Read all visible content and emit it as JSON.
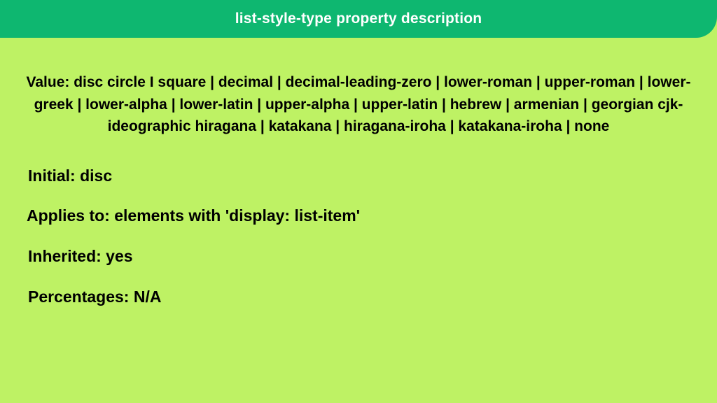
{
  "header": {
    "title": "list-style-type property description"
  },
  "content": {
    "value_line": "Value:  disc circle I square | decimal | decimal-leading-zero | lower-roman | upper-roman | lower- greek | lower-alpha | lower-latin | upper-alpha | upper-latin | hebrew | armenian | georgian cjk-ideographic hiragana | katakana | hiragana-iroha | katakana-iroha | none",
    "initial": "Initial: disc",
    "applies_to": "Applies to: elements with 'display: list-item'",
    "inherited": "Inherited: yes",
    "percentages": "Percentages: N/A"
  }
}
